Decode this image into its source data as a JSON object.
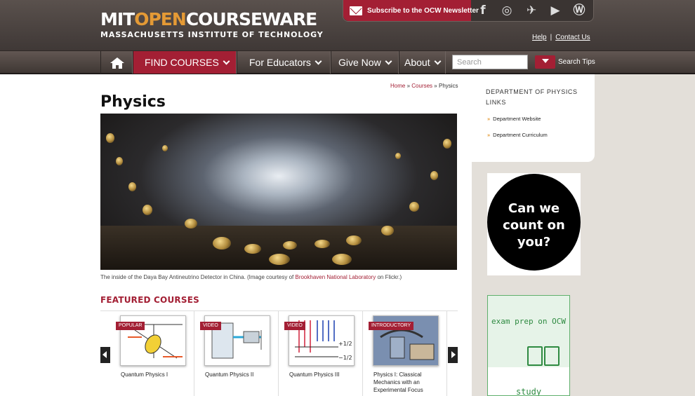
{
  "header": {
    "logo_left": "MIT",
    "logo_orange": "OPEN",
    "logo_right": "COURSEWARE",
    "logo_sub": "MASSACHUSETTS INSTITUTE OF TECHNOLOGY",
    "newsletter_label": "Subscribe to the OCW Newsletter",
    "social": [
      {
        "name": "facebook-icon",
        "glyph": "f"
      },
      {
        "name": "instagram-icon",
        "glyph": "◎"
      },
      {
        "name": "twitter-icon",
        "glyph": "✈"
      },
      {
        "name": "youtube-icon",
        "glyph": "▶"
      },
      {
        "name": "wordpress-icon",
        "glyph": "Ⓦ"
      }
    ],
    "help": "Help",
    "contact": "Contact Us"
  },
  "nav": {
    "find_courses": "FIND COURSES",
    "educators": "For Educators",
    "give_now": "Give Now",
    "about": "About",
    "search_placeholder": "Search",
    "search_tips": "Search Tips"
  },
  "breadcrumb": {
    "home": "Home",
    "courses": "Courses",
    "current": "Physics",
    "sep": "»"
  },
  "page_title": "Physics",
  "caption": {
    "before": "The inside of the Daya Bay Antineutrino Detector in China. (Image courtesy of ",
    "link": "Brookhaven National Laboratory",
    "after": " on Flickr.)"
  },
  "featured": {
    "heading": "FEATURED COURSES",
    "cards": [
      {
        "badge": "POPULAR",
        "title": "Quantum Physics I"
      },
      {
        "badge": "VIDEO",
        "title": "Quantum Physics II"
      },
      {
        "badge": "VIDEO",
        "title": "Quantum Physics III"
      },
      {
        "badge": "INTRODUCTORY",
        "title": "Physics I: Classical Mechanics with an Experimental Focus"
      }
    ]
  },
  "sidebar": {
    "heading": "DEPARTMENT OF PHYSICS LINKS",
    "links": [
      "Department Website",
      "Department Curriculum"
    ]
  },
  "ads": {
    "donate": "Can we count on you?",
    "exam": "exam prep on OCW",
    "study": "study"
  },
  "colors": {
    "accent": "#a31f34",
    "orange": "#e49a35"
  }
}
